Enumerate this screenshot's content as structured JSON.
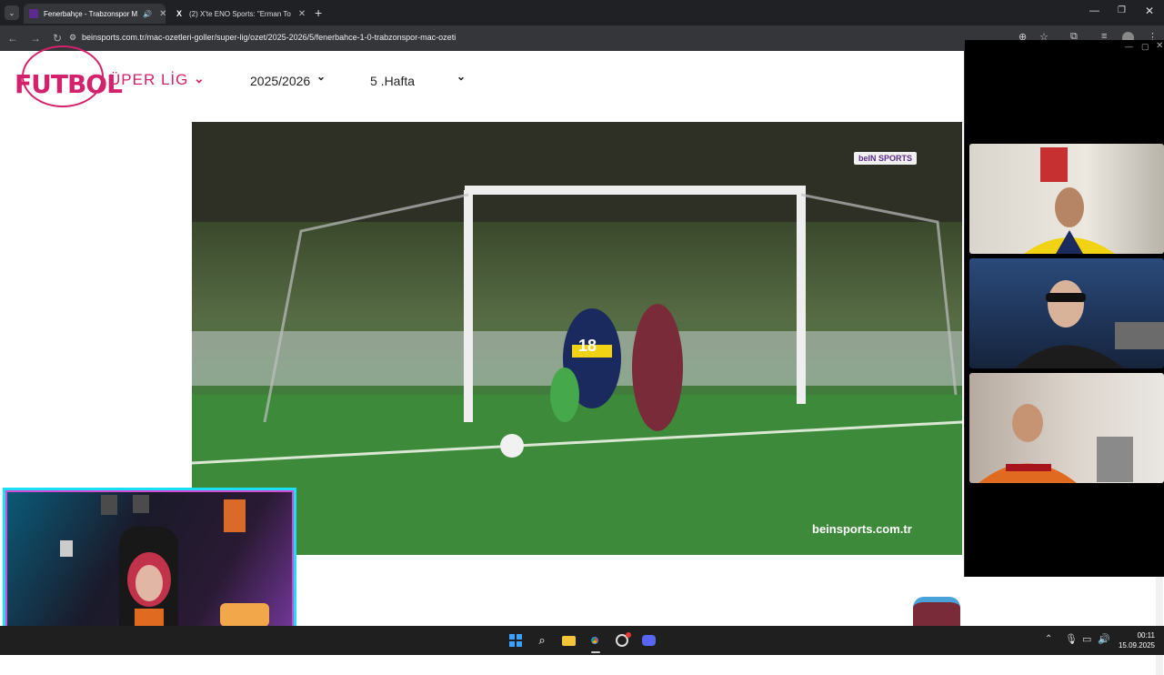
{
  "browser": {
    "tabs": [
      {
        "title": "Fenerbahçe - Trabzonspor M",
        "active": true
      },
      {
        "title": "(2) X'te ENO Sports: \"Erman To",
        "active": false
      }
    ],
    "url": "beinsports.com.tr/mac-ozetleri-goller/super-lig/ozet/2025-2026/5/fenerbahce-1-0-trabzonspor-mac-ozeti"
  },
  "overlay": {
    "logo_text": "FUTBOL"
  },
  "filters": {
    "league": "ÜPER LİG",
    "season": "2025/2026",
    "week": "5 .Hafta"
  },
  "video": {
    "channel_logo": "beIN SPORTS",
    "watermark": "beinsports.com.tr",
    "player_number": "18"
  },
  "taskbar": {
    "time": "00:11",
    "date": "15.09.2025"
  },
  "colors": {
    "accent_pink": "#d3226b",
    "fb_yellow": "#f2d313",
    "fb_navy": "#1b2a5e",
    "ts_claret": "#7a2b3a",
    "stream_frame_cyan": "#19e0f5"
  }
}
